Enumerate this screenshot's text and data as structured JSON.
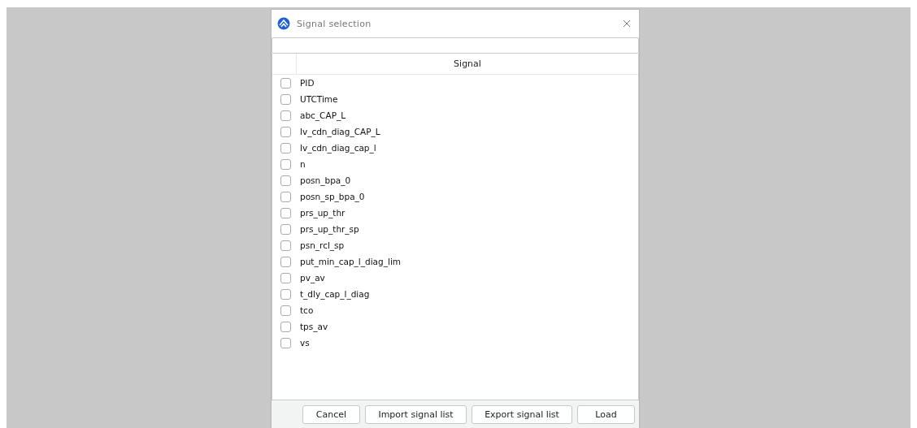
{
  "window": {
    "title": "Signal selection"
  },
  "table": {
    "columns": [
      "Signal"
    ],
    "rows": [
      {
        "name": "PID",
        "checked": false
      },
      {
        "name": "UTCTime",
        "checked": false
      },
      {
        "name": "abc_CAP_L",
        "checked": false
      },
      {
        "name": "lv_cdn_diag_CAP_L",
        "checked": false
      },
      {
        "name": "lv_cdn_diag_cap_l",
        "checked": false
      },
      {
        "name": "n",
        "checked": false
      },
      {
        "name": "posn_bpa_0",
        "checked": false
      },
      {
        "name": "posn_sp_bpa_0",
        "checked": false
      },
      {
        "name": "prs_up_thr",
        "checked": false
      },
      {
        "name": "prs_up_thr_sp",
        "checked": false
      },
      {
        "name": "psn_rcl_sp",
        "checked": false
      },
      {
        "name": "put_min_cap_l_diag_lim",
        "checked": false
      },
      {
        "name": "pv_av",
        "checked": false
      },
      {
        "name": "t_dly_cap_l_diag",
        "checked": false
      },
      {
        "name": "tco",
        "checked": false
      },
      {
        "name": "tps_av",
        "checked": false
      },
      {
        "name": "vs",
        "checked": false
      }
    ]
  },
  "buttons": [
    "Cancel",
    "Import signal list",
    "Export signal list",
    "Load"
  ]
}
